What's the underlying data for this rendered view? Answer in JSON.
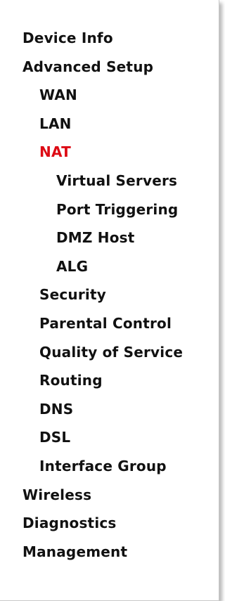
{
  "menu": {
    "device_info": "Device Info",
    "advanced_setup": "Advanced Setup",
    "wan": "WAN",
    "lan": "LAN",
    "nat": "NAT",
    "virtual_servers": "Virtual Servers",
    "port_triggering": "Port Triggering",
    "dmz_host": "DMZ Host",
    "alg": "ALG",
    "security": "Security",
    "parental_control": "Parental Control",
    "quality_of_service": "Quality of Service",
    "routing": "Routing",
    "dns": "DNS",
    "dsl": "DSL",
    "interface_group": "Interface Group",
    "wireless": "Wireless",
    "diagnostics": "Diagnostics",
    "management": "Management"
  },
  "colors": {
    "active": "#dd0a14",
    "text": "#111111"
  }
}
